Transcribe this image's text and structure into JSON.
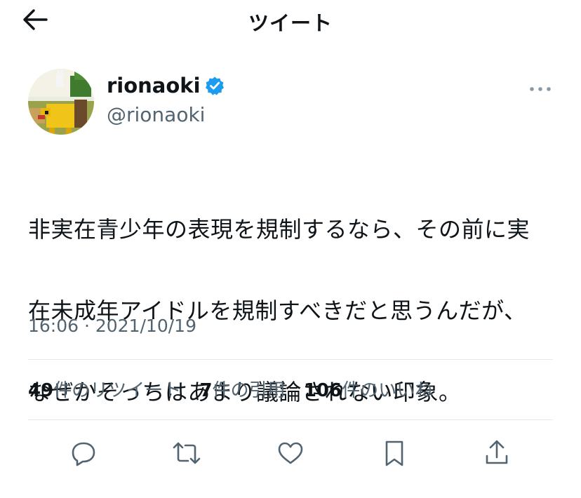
{
  "header": {
    "title": "ツイート",
    "back_icon": "arrow-left-icon"
  },
  "author": {
    "display_name": "rionaoki",
    "handle": "@rionaoki",
    "verified": true,
    "verified_color": "#1d9bf0"
  },
  "tweet": {
    "text_lines": [
      "非実在青少年の表現を規制するなら、その前に実",
      "在未成年アイドルを規制すべきだと思うんだが、",
      "なぜかそっちはあまり議論されない印象。"
    ],
    "timestamp": "16:06 · 2021/10/19"
  },
  "stats": {
    "retweets": {
      "count": "49",
      "label": "件のリツイート"
    },
    "quotes": {
      "count": "7",
      "label": "件の引用"
    },
    "likes": {
      "count": "106",
      "label": "件のいいね"
    }
  },
  "actions": [
    "reply-icon",
    "retweet-icon",
    "like-icon",
    "bookmark-icon",
    "share-icon"
  ],
  "colors": {
    "text": "#0f1419",
    "secondary": "#536471",
    "divider": "#e6e9eb",
    "accent": "#1d9bf0"
  }
}
